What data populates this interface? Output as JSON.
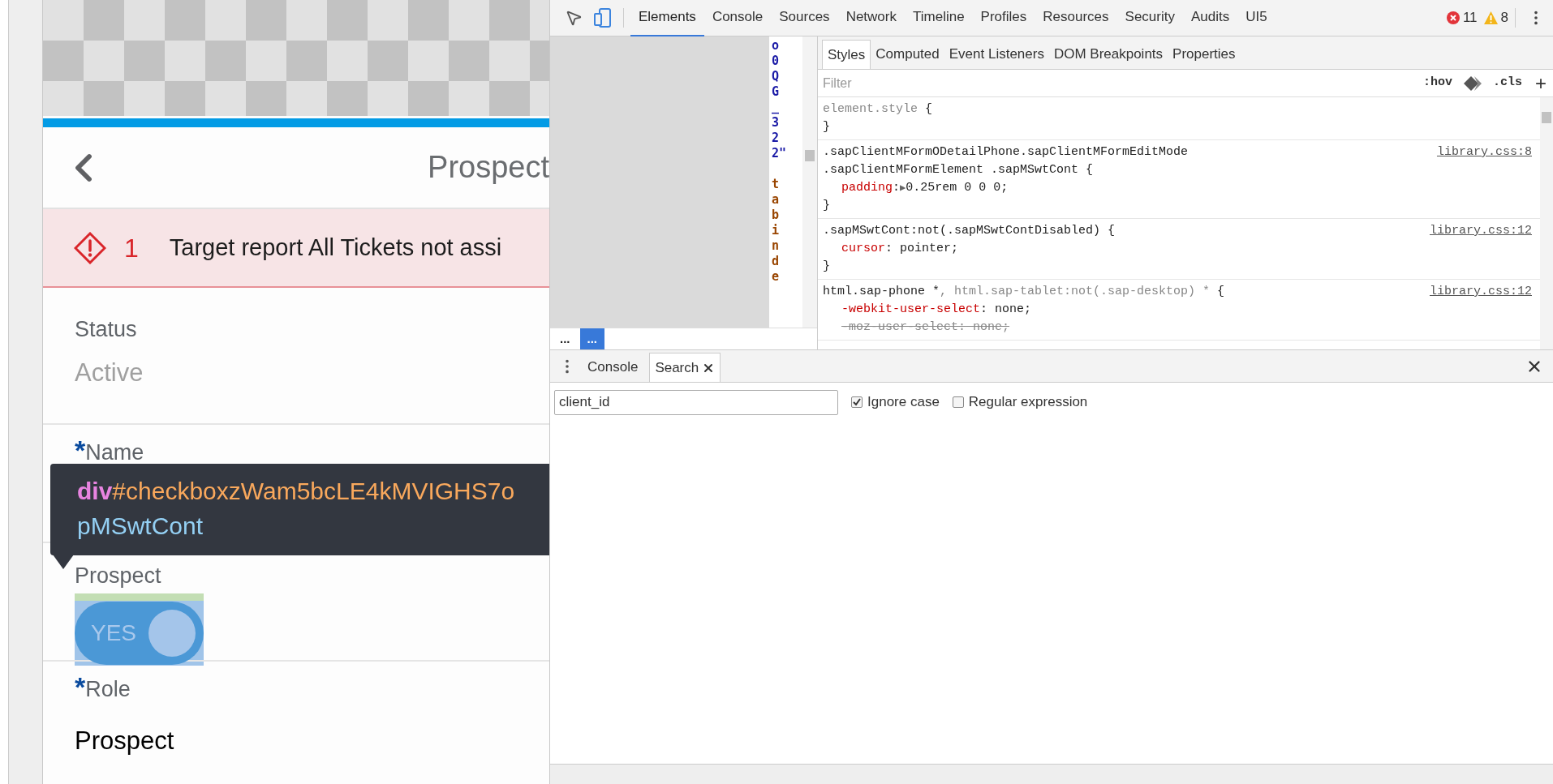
{
  "app": {
    "header": {
      "title": "Prospect"
    },
    "message_strip": {
      "count": "1",
      "text": "Target report All Tickets not assi"
    },
    "fields": [
      {
        "kind": "text",
        "label": "Status",
        "required": false,
        "value": "Active",
        "editable": false
      },
      {
        "kind": "text",
        "label": "Name",
        "required": true,
        "asterisk": "*"
      },
      {
        "kind": "switch",
        "label": "Prospect",
        "required": false,
        "on": true,
        "highlighted": true,
        "switch_text": "YES"
      },
      {
        "kind": "text",
        "label": "Role",
        "required": true,
        "asterisk": "*",
        "value": "Prospect",
        "editable": true
      }
    ],
    "tooltip": {
      "tag": "div",
      "id": "#checkboxzWam5bcLE4kMVIGHS7o",
      "class_line": "pMSwtCont"
    }
  },
  "devtools": {
    "tabs": [
      {
        "label": "Elements",
        "selected": true
      },
      {
        "label": "Console",
        "selected": false
      },
      {
        "label": "Sources",
        "selected": false
      },
      {
        "label": "Network",
        "selected": false
      },
      {
        "label": "Timeline",
        "selected": false
      },
      {
        "label": "Profiles",
        "selected": false
      },
      {
        "label": "Resources",
        "selected": false
      },
      {
        "label": "Security",
        "selected": false
      },
      {
        "label": "Audits",
        "selected": false
      },
      {
        "label": "UI5",
        "selected": false
      }
    ],
    "errors": "11",
    "warnings": "8",
    "dom_chars": [
      {
        "text": "o",
        "color": "#1a1aa6"
      },
      {
        "text": "0",
        "color": "#1a1aa6"
      },
      {
        "text": "Q",
        "color": "#1a1aa6"
      },
      {
        "text": "G",
        "color": "#1a1aa6"
      },
      {
        "text": "_",
        "color": "#1a1aa6"
      },
      {
        "text": "3",
        "color": "#1a1aa6"
      },
      {
        "text": "2",
        "color": "#1a1aa6"
      },
      {
        "text": "2\"",
        "color": "#1a1aa6"
      },
      {
        "text": "t",
        "color": "#994500",
        "space_before": true
      },
      {
        "text": "a",
        "color": "#994500"
      },
      {
        "text": "b",
        "color": "#994500"
      },
      {
        "text": "i",
        "color": "#994500"
      },
      {
        "text": "n",
        "color": "#994500"
      },
      {
        "text": "d",
        "color": "#994500"
      },
      {
        "text": "e",
        "color": "#994500"
      }
    ],
    "breadcrumbs": [
      {
        "label": "...",
        "selected": false
      },
      {
        "label": "...",
        "selected": true
      }
    ],
    "style_tabs": [
      {
        "label": "Styles",
        "selected": true
      },
      {
        "label": "Computed",
        "selected": false
      },
      {
        "label": "Event Listeners",
        "selected": false
      },
      {
        "label": "DOM Breakpoints",
        "selected": false
      },
      {
        "label": "Properties",
        "selected": false
      }
    ],
    "filter": {
      "placeholder": "Filter"
    },
    "hov": ":hov",
    "cls": ".cls",
    "add": "+",
    "rules": [
      {
        "selector_lines": [
          [
            {
              "text": "element.style",
              "matched": false
            },
            {
              "text": " {",
              "matched": true
            }
          ]
        ],
        "close": "}"
      },
      {
        "source": "library.css:8",
        "selector_lines": [
          [
            {
              "text": ".sapClientMFormODetailPhone.sapClientMFormEditMode",
              "matched": true
            }
          ],
          [
            {
              "text": ".sapClientMFormElement .sapMSwtCont {",
              "matched": true
            }
          ]
        ],
        "properties": [
          {
            "name": "padding",
            "separator": ":",
            "toggle": "▶",
            "value": "0.25rem 0 0 0;",
            "struck": false
          }
        ],
        "close": "}"
      },
      {
        "source": "library.css:12",
        "selector_lines": [
          [
            {
              "text": ".sapMSwtCont:not(.sapMSwtContDisabled) {",
              "matched": true
            }
          ]
        ],
        "properties": [
          {
            "name": "cursor",
            "separator": ":",
            "value": "pointer;",
            "struck": false
          }
        ],
        "close": "}"
      },
      {
        "source": "library.css:12",
        "selector_lines": [
          [
            {
              "text": "html.sap-phone *",
              "matched": true
            },
            {
              "text": ", html.sap-tablet:not(.sap-desktop) *",
              "matched": false
            },
            {
              "text": " {",
              "matched": true
            }
          ]
        ],
        "properties": [
          {
            "name": "-webkit-user-select",
            "separator": ":",
            "value": "none;",
            "struck": false
          },
          {
            "name": "-moz-user-select",
            "separator": ":",
            "value": "none;",
            "struck": true
          }
        ]
      }
    ],
    "drawer_tabs": [
      {
        "label": "Console",
        "selected": false,
        "closable": false
      },
      {
        "label": "Search",
        "selected": true,
        "closable": true
      }
    ],
    "search": {
      "value": "client_id",
      "options": [
        {
          "label": "Ignore case",
          "checked": true
        },
        {
          "label": "Regular expression",
          "checked": false
        }
      ]
    }
  }
}
